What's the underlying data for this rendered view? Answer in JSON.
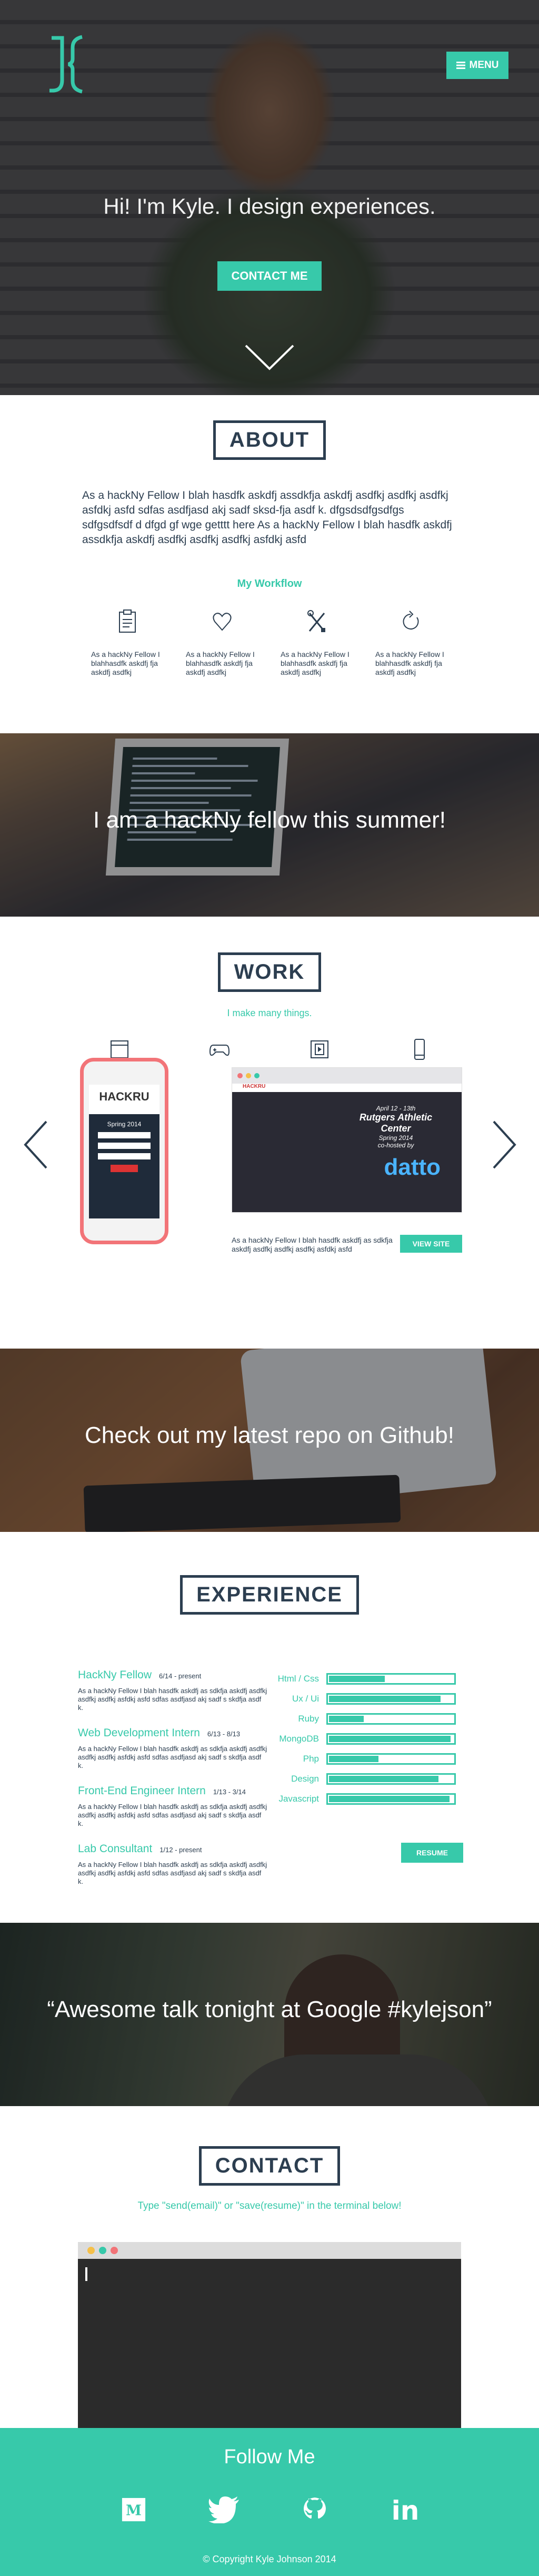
{
  "nav": {
    "menu_label": "MENU"
  },
  "hero": {
    "title": "Hi! I'm Kyle. I design experiences.",
    "contact_label": "CONTACT ME"
  },
  "about": {
    "title": "ABOUT",
    "text": "As a hackNy Fellow I blah hasdfk askdfj assdkfja askdfj asdfkj asdfkj asdfkj asfdkj asfd sdfas asdfjasd akj sadf sksd-fja asdf k. dfgsdsdfgsdfgs sdfgsdfsdf  d dfgd gf wge getttt here As a hackNy Fellow I blah hasdfk askdfj assdkfja askdfj asdfkj asdfkj asdfkj asfdkj asfd",
    "workflow_title": "My Workflow",
    "workflow": [
      {
        "icon": "clipboard-icon",
        "text": "As a hackNy Fellow I blahhasdfk askdfj fja askdfj asdfkj"
      },
      {
        "icon": "heart-icon",
        "text": "As a hackNy Fellow I blahhasdfk askdfj fja askdfj asdfkj"
      },
      {
        "icon": "tools-icon",
        "text": "As a hackNy Fellow I blahhasdfk askdfj fja askdfj asdfkj"
      },
      {
        "icon": "refresh-icon",
        "text": "As a hackNy Fellow I blahhasdfk askdfj fja askdfj asdfkj"
      }
    ]
  },
  "band1": {
    "text": "I am a hackNy fellow this summer!"
  },
  "work": {
    "title": "WORK",
    "subtitle": "I make many things.",
    "categories": [
      "browser-icon",
      "gamepad-icon",
      "film-icon",
      "mobile-icon"
    ],
    "phone": {
      "brand": "HACKRU",
      "season": "Spring 2014"
    },
    "site": {
      "brand": "HACKRU",
      "event_date": "April 12 - 13th",
      "event_place": "Rutgers Athletic Center",
      "event_season": "Spring 2014",
      "cohost": "co-hosted by",
      "sponsor": "datto"
    },
    "project_desc": "As a hackNy Fellow I blah hasdfk askdfj as sdkfja askdfj asdfkj asdfkj asdfkj asfdkj asfd",
    "view_label": "VIEW SITE"
  },
  "band2": {
    "text": "Check out my latest repo on Github!"
  },
  "experience": {
    "title": "EXPERIENCE",
    "jobs": [
      {
        "role": "HackNy Fellow",
        "dates": "6/14 - present",
        "desc": "As a hackNy Fellow I blah hasdfk askdfj as sdkfja askdfj asdfkj asdfkj asdfkj asfdkj asfd sdfas asdfjasd akj sadf s skdfja asdf k."
      },
      {
        "role": "Web Development Intern",
        "dates": "6/13 - 8/13",
        "desc": "As a hackNy Fellow I blah hasdfk askdfj as sdkfja askdfj asdfkj asdfkj asdfkj asfdkj asfd sdfas asdfjasd akj sadf s skdfja asdf k."
      },
      {
        "role": "Front-End Engineer Intern",
        "dates": "1/13 - 3/14",
        "desc": "As a hackNy Fellow I blah hasdfk askdfj as sdkfja askdfj asdfkj asdfkj asdfkj asfdkj asfd sdfas asdfjasd akj sadf s skdfja asdf k."
      },
      {
        "role": "Lab Consultant",
        "dates": "1/12 - present",
        "desc": "As a hackNy Fellow I blah hasdfk askdfj as sdkfja askdfj asdfkj asdfkj asdfkj asfdkj asfd sdfas asdfjasd akj sadf s skdfja asdf k."
      }
    ],
    "skills": [
      {
        "name": "Html / Css",
        "level": 0.45
      },
      {
        "name": "Ux / Ui",
        "level": 0.9
      },
      {
        "name": "Ruby",
        "level": 0.28
      },
      {
        "name": "MongoDB",
        "level": 0.98
      },
      {
        "name": "Php",
        "level": 0.4
      },
      {
        "name": "Design",
        "level": 0.88
      },
      {
        "name": "Javascript",
        "level": 0.97
      }
    ],
    "resume_label": "RESUME"
  },
  "band3": {
    "text": "“Awesome talk tonight at Google #kylejson”"
  },
  "contact": {
    "title": "CONTACT",
    "instructions": "Type \"send(email)\" or \"save(resume)\" in the terminal below!"
  },
  "footer": {
    "follow": "Follow Me",
    "socials": [
      "medium-icon",
      "twitter-icon",
      "github-icon",
      "linkedin-icon"
    ],
    "medium_letter": "M",
    "linkedin_letters": "in",
    "copyright": "© Copyright Kyle Johnson 2014"
  },
  "colors": {
    "accent": "#37c9aa",
    "navy": "#2c3e50",
    "footer": "#37c9aa"
  }
}
